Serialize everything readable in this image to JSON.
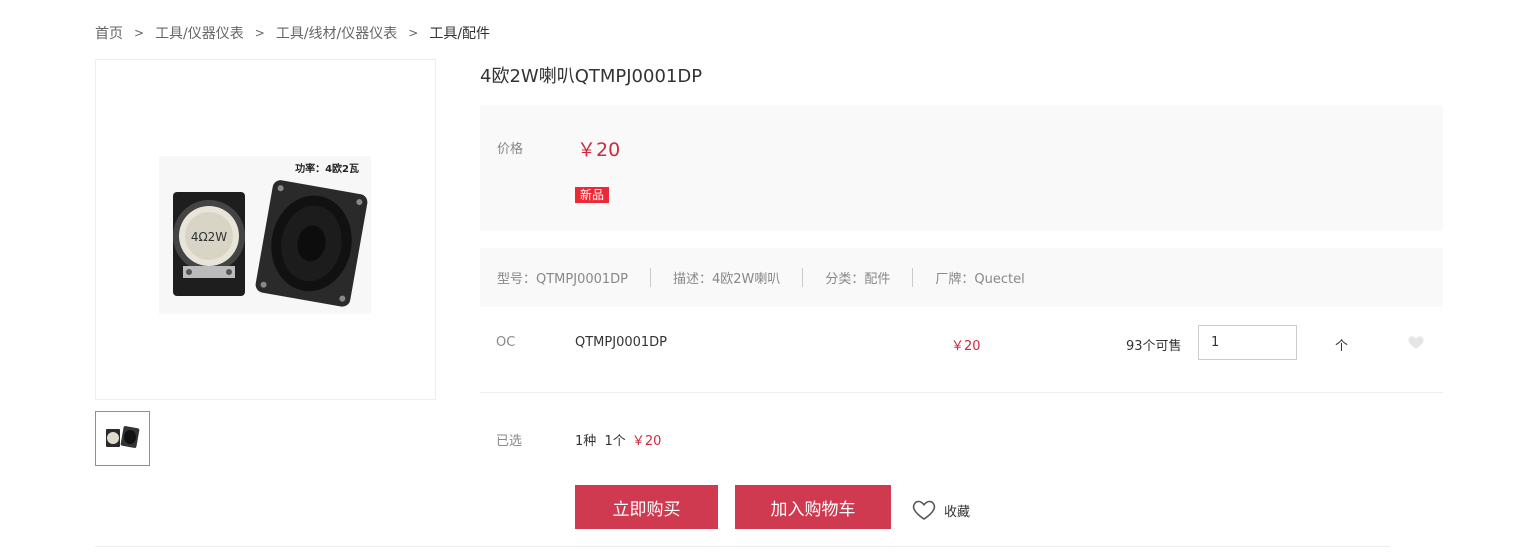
{
  "breadcrumb": {
    "items": [
      "首页",
      "工具/仪器仪表",
      "工具/线材/仪器仪表",
      "工具/配件"
    ],
    "separator": ">"
  },
  "product": {
    "image_caption": "功率：4欧2瓦",
    "image_speaker_label": "4Ω2W",
    "title": "4欧2W喇叭QTMPJ0001DP"
  },
  "price_box": {
    "label": "价格",
    "price": "￥20",
    "badge": "新品"
  },
  "specs": [
    "型号：QTMPJ0001DP",
    "描述：4欧2W喇叭",
    "分类：配件",
    "厂牌：Quectel"
  ],
  "variant": {
    "oc": "OC",
    "model": "QTMPJ0001DP",
    "price": "￥20",
    "stock": "93个可售",
    "quantity": "1",
    "unit": "个"
  },
  "selected": {
    "label": "已选",
    "summary": "1种  1个",
    "price": "￥20"
  },
  "actions": {
    "buy_now": "立即购买",
    "add_to_cart": "加入购物车",
    "favorite": "收藏"
  },
  "colors": {
    "accent_red": "#cf2a3e",
    "button_red": "#cf3a51",
    "badge_red": "#ec2a37",
    "thumb_border": "#d97a3a"
  }
}
